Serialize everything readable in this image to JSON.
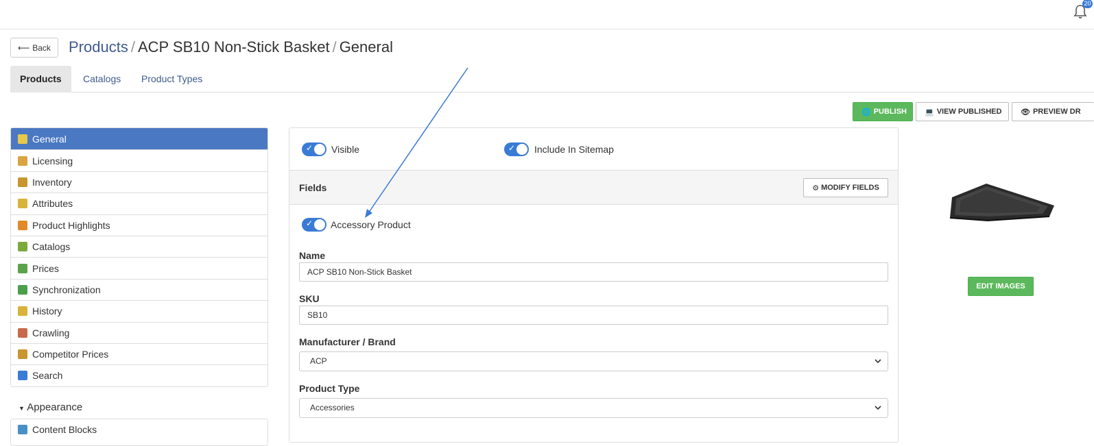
{
  "notifications": {
    "count": "20"
  },
  "header": {
    "back_label": "Back",
    "breadcrumb": [
      "Products",
      "ACP SB10 Non-Stick Basket",
      "General"
    ]
  },
  "tabs": [
    "Products",
    "Catalogs",
    "Product Types"
  ],
  "actions": {
    "publish": "PUBLISH",
    "view_published": "VIEW PUBLISHED",
    "preview": "PREVIEW DR"
  },
  "sidebar": {
    "items": [
      {
        "label": "General",
        "icon": "general-icon",
        "color": "#e6c84a"
      },
      {
        "label": "Licensing",
        "icon": "licensing-icon",
        "color": "#d9a441"
      },
      {
        "label": "Inventory",
        "icon": "inventory-icon",
        "color": "#c8952e"
      },
      {
        "label": "Attributes",
        "icon": "attributes-icon",
        "color": "#d9b23a"
      },
      {
        "label": "Product Highlights",
        "icon": "highlights-icon",
        "color": "#e08a2c"
      },
      {
        "label": "Catalogs",
        "icon": "catalogs-icon",
        "color": "#7aa93c"
      },
      {
        "label": "Prices",
        "icon": "prices-icon",
        "color": "#5aa34a"
      },
      {
        "label": "Synchronization",
        "icon": "sync-icon",
        "color": "#4aa04a"
      },
      {
        "label": "History",
        "icon": "history-icon",
        "color": "#d9b23a"
      },
      {
        "label": "Crawling",
        "icon": "crawling-icon",
        "color": "#c86a4a"
      },
      {
        "label": "Competitor Prices",
        "icon": "competitor-icon",
        "color": "#c8952e"
      },
      {
        "label": "Search",
        "icon": "search-icon",
        "color": "#3a7bd5"
      }
    ],
    "appearance_label": "Appearance",
    "appearance_items": [
      {
        "label": "Content Blocks",
        "icon": "content-blocks-icon",
        "color": "#4a90c8"
      }
    ]
  },
  "panel": {
    "visible_label": "Visible",
    "sitemap_label": "Include In Sitemap",
    "fields_title": "Fields",
    "modify_fields": "MODIFY FIELDS",
    "accessory_label": "Accessory Product",
    "name_label": "Name",
    "name_value": "ACP SB10 Non-Stick Basket",
    "sku_label": "SKU",
    "sku_value": "SB10",
    "brand_label": "Manufacturer / Brand",
    "brand_value": "ACP",
    "type_label": "Product Type",
    "type_value": "Accessories"
  },
  "edit_images": "EDIT IMAGES",
  "colors": {
    "accent": "#4a78c2",
    "link": "#3f5a8d",
    "success": "#5cb85c",
    "toggle": "#3a7bd5"
  }
}
